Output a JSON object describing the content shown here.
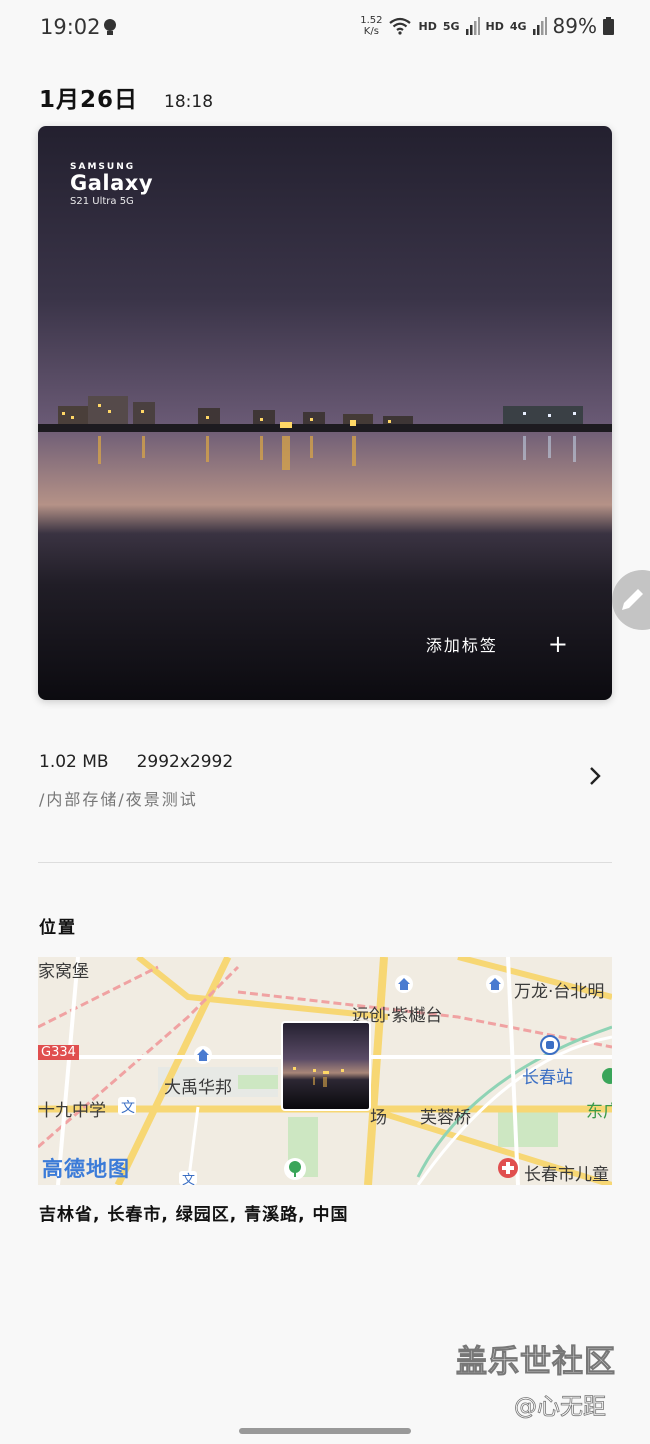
{
  "status_bar": {
    "time": "19:02",
    "net_speed_value": "1.52",
    "net_speed_unit": "K/s",
    "hd_1": "HD",
    "net_1": "5G",
    "hd_2": "HD",
    "net_2": "4G",
    "battery": "89%"
  },
  "header": {
    "date": "1月26日",
    "time": "18:18"
  },
  "photo": {
    "watermark_brand": "SAMSUNG",
    "watermark_model": "Galaxy",
    "watermark_sub": "S21 Ultra 5G",
    "add_tag_label": "添加标签",
    "add_tag_icon": "+"
  },
  "file_info": {
    "size": "1.02 MB",
    "resolution": "2992x2992",
    "path": "/内部存储/夜景测试"
  },
  "location": {
    "heading": "位置",
    "address": "吉林省, 长春市, 绿园区, 青溪路, 中国",
    "map": {
      "labels": {
        "l1": "家窝堡",
        "l2": "远创·紫樾台",
        "l3": "万龙·台北明",
        "l4": "大禹华邦",
        "l5": "长春站",
        "l6": "十九中学",
        "l7": "芙蓉桥",
        "l8": "东广",
        "l9": "长春市儿童",
        "l10": "场"
      },
      "road_badge": "G334",
      "logo": "高德地图"
    }
  },
  "watermark_overlay": {
    "community": "盖乐世社区",
    "author": "@心无距"
  }
}
